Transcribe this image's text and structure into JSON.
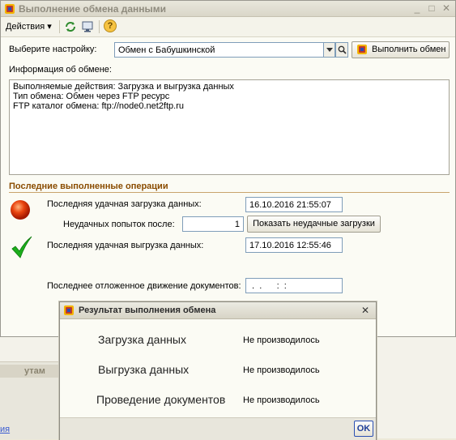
{
  "background_app": {
    "panel_header": "утам",
    "link_text": "ия"
  },
  "window": {
    "title": "Выполнение обмена данными",
    "controls": {
      "minimize": "_",
      "maximize": "□",
      "close": "✕"
    }
  },
  "toolbar": {
    "actions_label": "Действия",
    "dropdown_glyph": "▾",
    "help_glyph": "?"
  },
  "settings": {
    "label": "Выберите настройку:",
    "value": "Обмен с Бабушкинской",
    "run_button": "Выполнить обмен"
  },
  "info": {
    "label": "Информация об обмене:",
    "lines": [
      "Выполняемые действия: Загрузка и выгрузка данных",
      "Тип обмена:  Обмен через FTP ресурс",
      "FTP каталог обмена: ftp://node0.net2ftp.ru"
    ]
  },
  "operations": {
    "section_title": "Последние выполненные операции",
    "last_load_label": "Последняя удачная загрузка данных:",
    "last_load_value": "16.10.2016 21:55:07",
    "failed_attempts_label": "Неудачных попыток после:",
    "failed_attempts_value": "1",
    "show_failed_button": "Показать неудачные загрузки",
    "last_upload_label": "Последняя удачная выгрузка данных:",
    "last_upload_value": "17.10.2016 12:55:46",
    "deferred_label": "Последнее отложенное движение документов:",
    "deferred_value": " .  .      :  :"
  },
  "result_dialog": {
    "title": "Результат выполнения обмена",
    "close_glyph": "✕",
    "rows": [
      {
        "label": "Загрузка данных",
        "value": "Не производилось"
      },
      {
        "label": "Выгрузка данных",
        "value": "Не производилось"
      },
      {
        "label": "Проведение документов",
        "value": "Не производилось"
      }
    ],
    "ok_button": "OK"
  },
  "colors": {
    "accent_section": "#8a4c00",
    "status_error": "#d62a00",
    "status_ok": "#18b018"
  }
}
